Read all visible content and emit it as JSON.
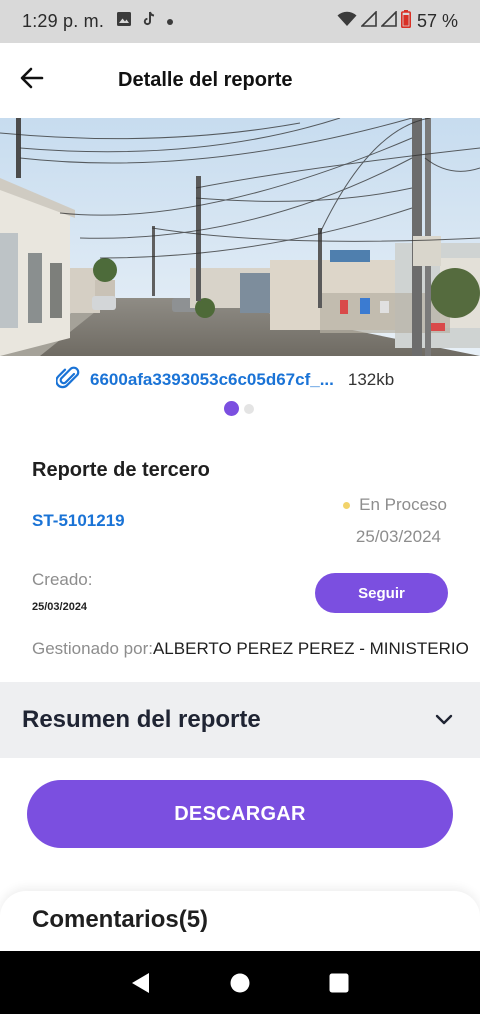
{
  "status_bar": {
    "time": "1:29 p. m.",
    "left_icons": [
      "image-icon",
      "tiktok-icon",
      "dot-icon"
    ],
    "right_icons": [
      "wifi-icon",
      "signal-icon",
      "signal-icon",
      "battery-low-icon"
    ],
    "battery": "57 %"
  },
  "app_bar": {
    "back_icon": "arrow-left-icon",
    "title": "Detalle del reporte"
  },
  "attachment": {
    "icon": "paperclip-icon",
    "name": "6600afa3393053c6c05d67cf_...",
    "size": "132kb",
    "carousel": {
      "count": 2,
      "active_index": 0
    }
  },
  "report": {
    "type": "Reporte de tercero",
    "id": "ST-5101219",
    "status": "En Proceso",
    "status_color": "#f2d36b",
    "date": "25/03/2024",
    "created_label": "Creado:",
    "created_date": "25/03/2024",
    "follow_label": "Seguir",
    "managed_label": "Gestionado por:",
    "managed_by": "ALBERTO PEREZ PEREZ - MINISTERIO"
  },
  "summary": {
    "title": "Resumen del reporte",
    "chevron_icon": "chevron-down-icon"
  },
  "download_label": "DESCARGAR",
  "comments": {
    "title": "Comentarios(5)"
  },
  "nav_bar": {
    "icons": [
      "nav-back-icon",
      "nav-home-icon",
      "nav-recents-icon"
    ]
  },
  "colors": {
    "accent": "#7b4fe0",
    "link": "#1a73d6",
    "status_bar_bg": "#d9d9d9",
    "summary_bg": "#eeeff1"
  }
}
